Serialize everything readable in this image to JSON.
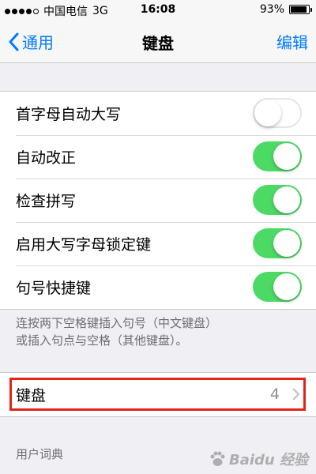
{
  "status_bar": {
    "carrier": "中国电信",
    "network": "3G",
    "time": "16:08",
    "battery": "93%",
    "battery_fraction": 0.93,
    "signal_bars_filled": 4,
    "signal_bars_total": 5
  },
  "nav": {
    "back_label": "通用",
    "title": "键盘",
    "edit_label": "编辑"
  },
  "settings": {
    "rows": [
      {
        "label": "首字母自动大写",
        "on": false
      },
      {
        "label": "自动改正",
        "on": true
      },
      {
        "label": "检查拼写",
        "on": true
      },
      {
        "label": "启用大写字母锁定键",
        "on": true
      },
      {
        "label": "句号快捷键",
        "on": true
      }
    ],
    "footer_line1": "连按两下空格键插入句号（中文键盘）",
    "footer_line2": "或插入句点与空格（其他键盘）。"
  },
  "keyboards": {
    "label": "键盘",
    "count": "4"
  },
  "user_dictionary": {
    "header": "用户词典"
  },
  "watermark": {
    "text": "Baidu 经验"
  },
  "colors": {
    "accent": "#007aff",
    "toggle_on": "#4cd964",
    "highlight_box": "#e2231a"
  }
}
